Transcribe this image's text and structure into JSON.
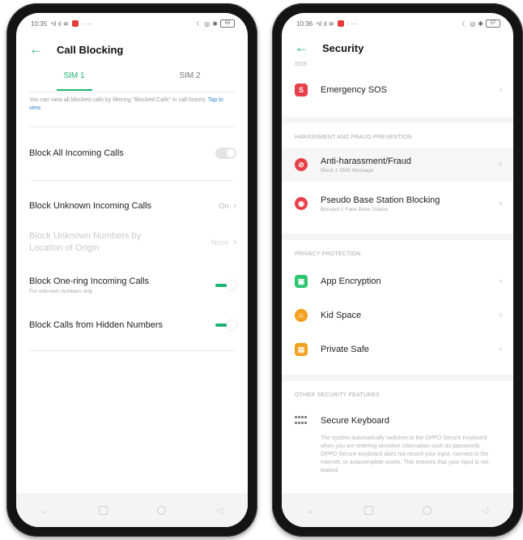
{
  "left_phone": {
    "status": {
      "time": "10:35",
      "signal": "ⵏ.ıl",
      "battery": "59"
    },
    "title": "Call Blocking",
    "tabs": [
      "SIM 1",
      "SIM 2"
    ],
    "info_text": "You can view all blocked calls by filtering \"Blocked Calls\" in call history.",
    "info_link": "Tap to view",
    "rows": {
      "block_all": {
        "label": "Block All Incoming Calls",
        "toggle": "off"
      },
      "block_unknown": {
        "label": "Block Unknown Incoming Calls",
        "value": "On"
      },
      "block_location": {
        "label": "Block Unknown Numbers by Location of Origin",
        "value": "None"
      },
      "block_one_ring": {
        "label": "Block One-ring Incoming Calls",
        "sub": "For unknown numbers only",
        "toggle": "on"
      },
      "block_hidden": {
        "label": "Block Calls from Hidden Numbers",
        "toggle": "on"
      }
    }
  },
  "right_phone": {
    "status": {
      "time": "10:36",
      "signal": "ⵏ.ıl",
      "battery": "57"
    },
    "title": "Security",
    "sections": {
      "sos": "SOS",
      "harassment": "HARASSMENT AND FRAUD PREVENTION",
      "privacy": "PRIVACY PROTECTION",
      "other": "OTHER SECURITY FEATURES"
    },
    "items": {
      "emergency_sos": {
        "label": "Emergency SOS",
        "icon_letter": "S"
      },
      "anti_harassment": {
        "label": "Anti-harassment/Fraud",
        "sub": "Block 1 SMS Message"
      },
      "pseudo_base": {
        "label": "Pseudo Base Station Blocking",
        "sub": "Blocked 1 Fake Base Station"
      },
      "app_encryption": {
        "label": "App Encryption"
      },
      "kid_space": {
        "label": "Kid Space"
      },
      "private_safe": {
        "label": "Private Safe"
      },
      "secure_keyboard": {
        "label": "Secure Keyboard",
        "desc": "The system automatically switches to the OPPO Secure Keyboard when you are entering sensitive information such as passwords. OPPO Secure Keyboard does not record your input, connect to the Internet, or autocomplete words. This ensures that your input is not leaked."
      }
    }
  },
  "colors": {
    "accent": "#1eb271",
    "red": "#e8404a",
    "green": "#2cc56f",
    "orange": "#f2a020"
  }
}
